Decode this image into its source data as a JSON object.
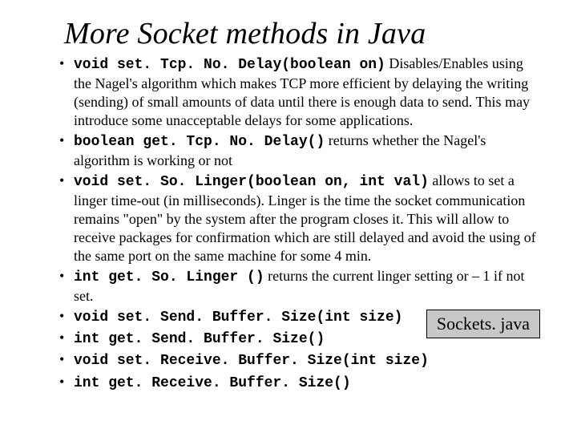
{
  "title": "More Socket methods in Java",
  "items": [
    {
      "code": "void set. Tcp. No. Delay(boolean on)",
      "text": " Disables/Enables using the Nagel's algorithm which makes TCP more efficient by delaying the writing (sending) of small amounts of data until there is enough data to send. This may introduce some unacceptable delays for some applications."
    },
    {
      "code": "boolean get. Tcp. No. Delay()",
      "text": " returns whether the Nagel's algorithm is working or not"
    },
    {
      "code": "void set. So. Linger(boolean on, int val)",
      "text": " allows to set a linger time-out (in milliseconds). Linger is the time the socket communication remains \"open\" by the system after the program closes it. This will allow to receive packages for confirmation which are still delayed and avoid the using of the same port on the same machine for some 4 min."
    },
    {
      "code": "int  get. So. Linger ()",
      "text": " returns the current linger setting or – 1 if not set."
    },
    {
      "code": "void set. Send. Buffer. Size(int size)",
      "text": ""
    },
    {
      "code": "int  get. Send. Buffer. Size()",
      "text": ""
    },
    {
      "code": "void set. Receive. Buffer. Size(int size)",
      "text": ""
    },
    {
      "code": "int  get. Receive. Buffer. Size()",
      "text": ""
    }
  ],
  "badge": "Sockets. java"
}
